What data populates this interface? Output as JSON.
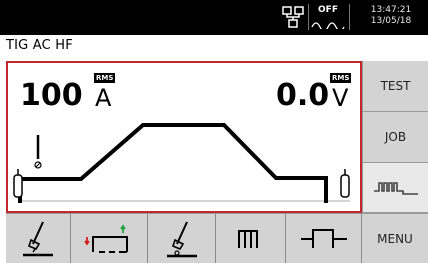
{
  "status_bar": {
    "off_label": "OFF",
    "time": "13:47:21",
    "date": "13/05/18",
    "icons": [
      "network-icon",
      "wave-icon"
    ]
  },
  "mode": "TIG AC HF",
  "display": {
    "current_value": "100",
    "current_unit": "A",
    "current_badge": "RMS",
    "voltage_value": "0.0",
    "voltage_unit": "V",
    "voltage_badge": "RMS"
  },
  "side_buttons": [
    "TEST",
    "JOB",
    "pulse-wave-icon"
  ],
  "bottom_buttons": [
    "torch-pre-icon",
    "trigger-mode-icon",
    "torch-post-icon",
    "pulse-icon",
    "square-wave-icon",
    "MENU"
  ],
  "colors": {
    "frame_red": "#c0282d",
    "button_gray": "#d3d3d3",
    "topbar": "#000000"
  }
}
